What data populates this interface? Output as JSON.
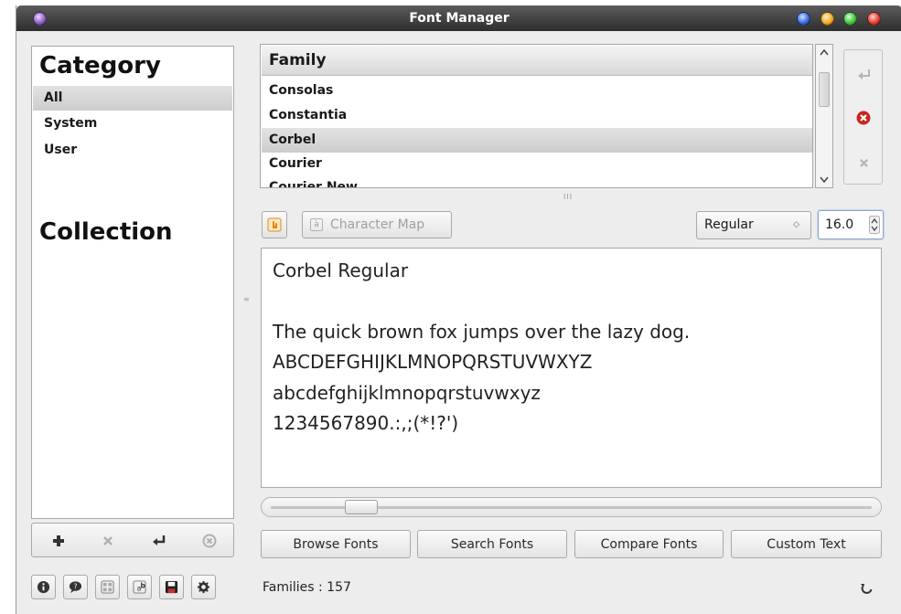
{
  "window": {
    "title": "Font Manager"
  },
  "titlebar_orbs": {
    "left": "#8a5cc2",
    "right": [
      "#2f64d8",
      "#f2a61e",
      "#3cbf3c",
      "#e0362c"
    ]
  },
  "sidebar": {
    "category_heading": "Category",
    "categories": [
      {
        "label": "All",
        "selected": true
      },
      {
        "label": "System",
        "selected": false
      },
      {
        "label": "User",
        "selected": false
      }
    ],
    "collection_heading": "Collection",
    "actions": {
      "add_icon": "plus-icon",
      "remove_icon": "x-icon",
      "edit_icon": "return-arrow-icon",
      "clear_icon": "circle-x-icon"
    }
  },
  "families": {
    "header": "Family",
    "items": [
      {
        "label": "Consolas",
        "selected": false
      },
      {
        "label": "Constantia",
        "selected": false
      },
      {
        "label": "Corbel",
        "selected": true
      },
      {
        "label": "Courier",
        "selected": false
      },
      {
        "label": "Courier New",
        "selected": false
      }
    ],
    "side_actions": [
      "return-arrow-icon",
      "remove-red-icon",
      "x-icon"
    ],
    "splitter_grip": "III"
  },
  "toolbar": {
    "char_map_label": "Character Map",
    "char_map_icon": "character-map-icon",
    "style_value": "Regular",
    "size_value": "16.0"
  },
  "preview": {
    "heading": "Corbel Regular",
    "lines": [
      "The quick brown fox jumps over the lazy dog.",
      "ABCDEFGHIJKLMNOPQRSTUVWXYZ",
      "abcdefghijklmnopqrstuvwxyz",
      "1234567890.:,;(*!?')"
    ],
    "zoom_fraction": 0.14
  },
  "mode_buttons": [
    "Browse Fonts",
    "Search Fonts",
    "Compare Fonts",
    "Custom Text"
  ],
  "statusbar": {
    "families_text": "Families : 157",
    "icons": [
      "info-icon",
      "speech-bubble-icon",
      "font-grid-icon",
      "ab-icon",
      "save-icon",
      "gear-icon"
    ],
    "refresh_icon": "refresh-icon"
  }
}
